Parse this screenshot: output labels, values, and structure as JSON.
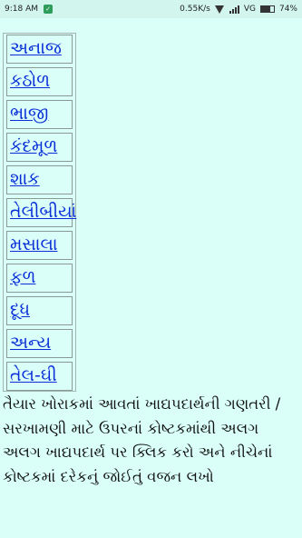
{
  "status_bar": {
    "time": "9:18 AM",
    "speed": "0.55K/s",
    "network": "VG",
    "battery": "74%",
    "battery_level": 0.74
  },
  "menu": {
    "items": [
      {
        "label": "અનાજ"
      },
      {
        "label": "કઠોળ"
      },
      {
        "label": "ભાજી"
      },
      {
        "label": "કંદમૂળ"
      },
      {
        "label": "શાક"
      },
      {
        "label": "તેલીબીયાં"
      },
      {
        "label": "મસાલા"
      },
      {
        "label": "ફળ"
      },
      {
        "label": "દૂધ"
      },
      {
        "label": "અન્ય"
      },
      {
        "label": "તેલ-ઘી"
      }
    ]
  },
  "description": {
    "text": "તૈયાર ખોરાકમાં આવતાં ખાદ્યપદાર્થની ગણતરી / સરખામણી માટે ઉપરનાં કોષ્ટકમાંથી અલગ અલગ ખાદ્યપદાર્થ પર ક્લિક કરો અને નીચેનાં કોષ્ટકમાં દરેકનું જોઈતું વજન લખો"
  }
}
